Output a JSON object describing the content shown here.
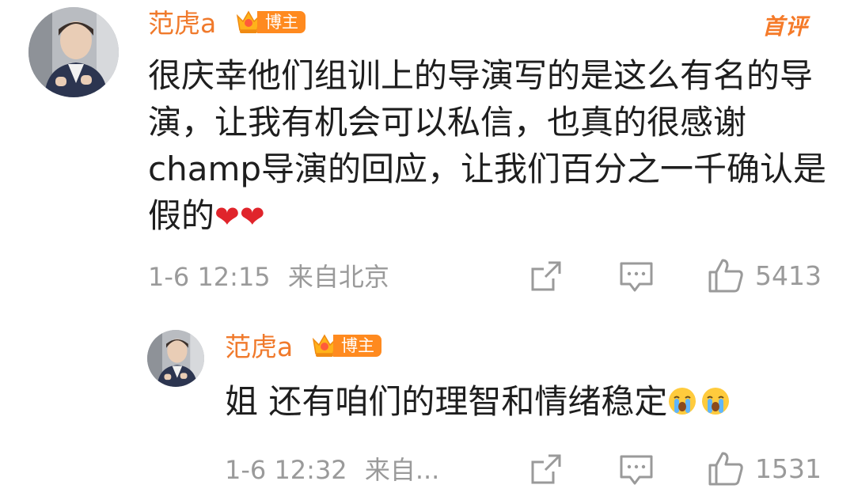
{
  "comment": {
    "author": "范虎a",
    "badge": "博主",
    "label": "首评",
    "text": "很庆幸他们组训上的导演写的是这么有名的导演，让我有机会可以私信，也真的很感谢champ导演的回应，让我们百分之一千确认是假的",
    "emoji": "❤❤",
    "time": "1-6 12:15",
    "location": "来自北京",
    "likes": "5413"
  },
  "reply": {
    "author": "范虎a",
    "badge": "博主",
    "text": "姐 还有咱们的理智和情绪稳定",
    "time": "1-6 12:32",
    "location": "来自...",
    "likes": "1531"
  },
  "icons": {
    "share": "share-icon",
    "comment": "comment-icon",
    "like": "thumbs-up-icon",
    "crown": "crown-badge-icon",
    "crying": "loudly-crying-face-icon"
  },
  "colors": {
    "accent": "#f07a2c",
    "badge": "#ff8a1f",
    "heart": "#e0242b",
    "meta": "#9a9a9a"
  }
}
